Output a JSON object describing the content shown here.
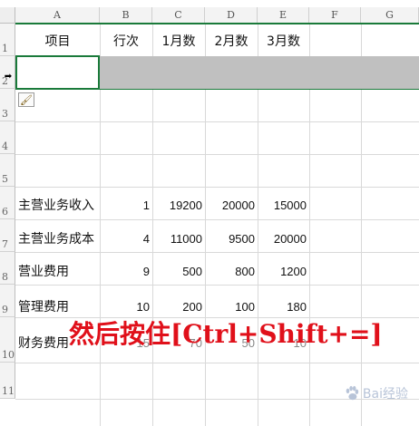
{
  "column_headers": [
    "A",
    "B",
    "C",
    "D",
    "E",
    "F",
    "G"
  ],
  "row_headers": [
    "1",
    "2",
    "3",
    "4",
    "5",
    "6",
    "7",
    "8",
    "9",
    "10",
    "11"
  ],
  "header_row": [
    "项目",
    "行次",
    "1月数",
    "2月数",
    "3月数"
  ],
  "rows": [
    {
      "label": "主营业务收入",
      "b": "1",
      "c": "19200",
      "d": "20000",
      "e": "15000"
    },
    {
      "label": "主营业务成本",
      "b": "4",
      "c": "11000",
      "d": "9500",
      "e": "20000"
    },
    {
      "label": "营业费用",
      "b": "9",
      "c": "500",
      "d": "800",
      "e": "1200"
    },
    {
      "label": "管理费用",
      "b": "10",
      "c": "200",
      "d": "100",
      "e": "180"
    },
    {
      "label": "财务费用",
      "b": "15",
      "c": "70",
      "d": "50",
      "e": "10"
    }
  ],
  "caption": "然后按住[Ctrl+Shift+=]",
  "watermark": "Bai经验",
  "icons": {
    "paste_options": "paste-options-icon",
    "row_insert": "insert-row-arrow-icon"
  },
  "colors": {
    "selection": "#1a7a3a",
    "caption": "#e0101a",
    "inserted_row": "#c0c0c0"
  }
}
